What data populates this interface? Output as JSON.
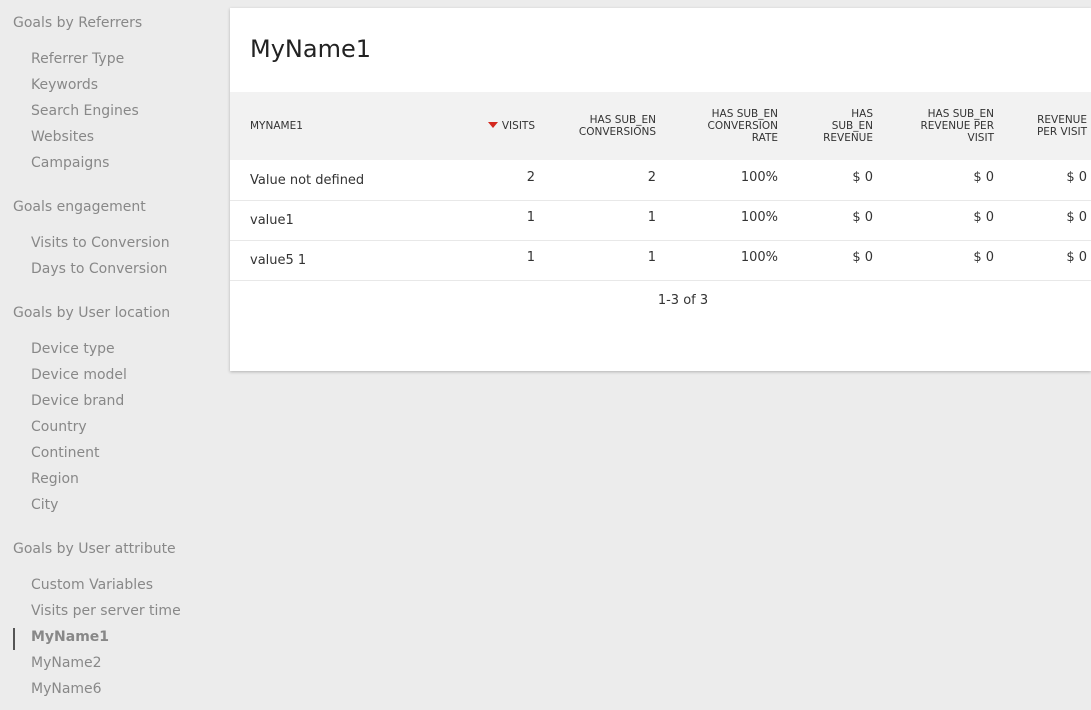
{
  "sidebar": {
    "groups": [
      {
        "title": "Goals by Referrers",
        "items": [
          "Referrer Type",
          "Keywords",
          "Search Engines",
          "Websites",
          "Campaigns"
        ]
      },
      {
        "title": "Goals engagement",
        "items": [
          "Visits to Conversion",
          "Days to Conversion"
        ]
      },
      {
        "title": "Goals by User location",
        "items": [
          "Device type",
          "Device model",
          "Device brand",
          "Country",
          "Continent",
          "Region",
          "City"
        ]
      },
      {
        "title": "Goals by User attribute",
        "items": [
          "Custom Variables",
          "Visits per server time",
          "MyName1",
          "MyName2",
          "MyName6"
        ]
      }
    ],
    "active_item": "MyName1"
  },
  "report": {
    "title": "MyName1",
    "columns": [
      "MYNAME1",
      "VISITS",
      "HAS SUB_EN CONVERSIONS",
      "HAS SUB_EN CONVERSION RATE",
      "HAS SUB_EN REVENUE",
      "HAS SUB_EN REVENUE PER VISIT",
      "REVENUE PER VISIT"
    ],
    "sorted_column": "VISITS",
    "sort_direction": "descending",
    "rows": [
      [
        "Value not defined",
        "2",
        "2",
        "100%",
        "$ 0",
        "$ 0",
        "$ 0"
      ],
      [
        "value1",
        "1",
        "1",
        "100%",
        "$ 0",
        "$ 0",
        "$ 0"
      ],
      [
        "value5 1",
        "1",
        "1",
        "100%",
        "$ 0",
        "$ 0",
        "$ 0"
      ]
    ],
    "pagination": "1-3 of 3"
  },
  "colors": {
    "background": "#ececec",
    "panel": "#ffffff",
    "header_bg": "#f2f2f2",
    "sort_arrow": "#d4291f",
    "sidebar_text": "#888888"
  }
}
